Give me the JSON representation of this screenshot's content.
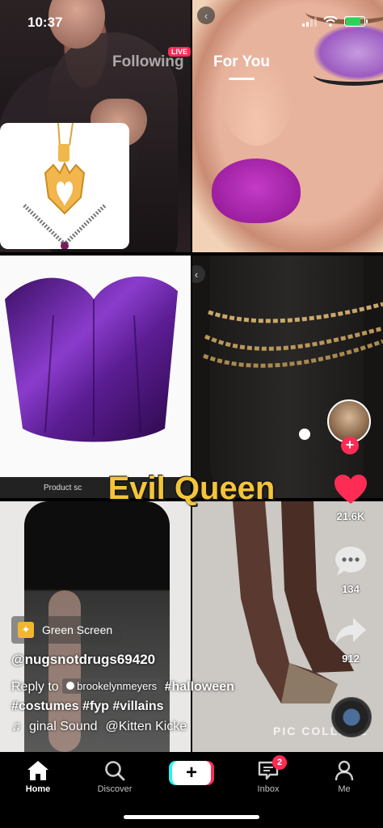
{
  "status_bar": {
    "time": "10:37"
  },
  "top_nav": {
    "following": "Following",
    "live_badge": "LIVE",
    "for_you": "For You"
  },
  "collage": {
    "product_caption": "Product sc",
    "watermark": "PIC COLLAGE"
  },
  "overlay_title": "Evil Queen",
  "right_rail": {
    "like_count": "21.6K",
    "comment_count": "134",
    "share_count": "912"
  },
  "info": {
    "effect_chip": "Green Screen",
    "username": "@nugsnotdrugs69420",
    "reply_prefix": "Reply to",
    "reply_user": "brookelynmeyers",
    "hashtags_line1": "#halloween",
    "hashtags_line2": [
      "#costumes",
      "#fyp",
      "#villains"
    ],
    "sound_text": "ginal Sound",
    "sound_artist": "@Kitten Kicke"
  },
  "tab_bar": {
    "home": "Home",
    "discover": "Discover",
    "inbox": "Inbox",
    "inbox_badge": "2",
    "me": "Me"
  },
  "colors": {
    "accent": "#fe2c55",
    "title_yellow": "#f4c53a",
    "cyan": "#25f4ee"
  },
  "icons": [
    "wifi-icon",
    "battery-icon",
    "heart-icon",
    "comment-icon",
    "share-icon",
    "music-note-icon",
    "home-icon",
    "search-icon",
    "plus-icon",
    "inbox-icon",
    "person-icon"
  ]
}
